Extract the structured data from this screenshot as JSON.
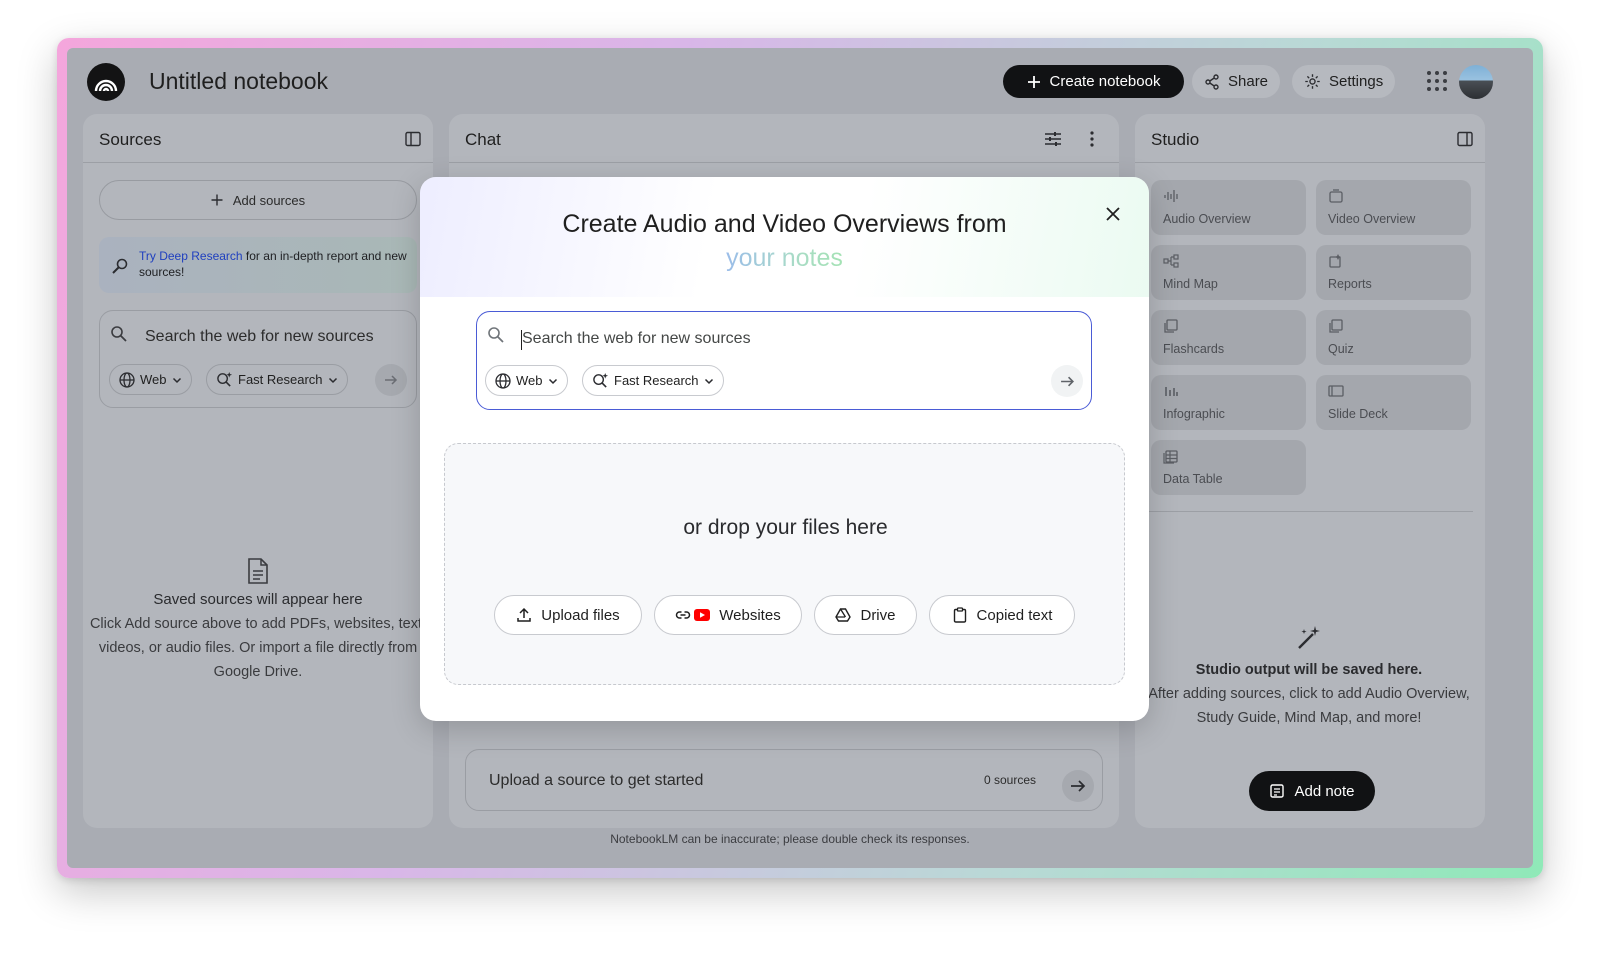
{
  "header": {
    "title": "Untitled notebook",
    "create_label": "Create notebook",
    "share_label": "Share",
    "settings_label": "Settings"
  },
  "sources": {
    "heading": "Sources",
    "add_label": "Add sources",
    "deep_research_link": "Try Deep Research",
    "deep_research_rest": " for an in-depth report and new sources!",
    "search_placeholder": "Search the web for new sources",
    "web_chip": "Web",
    "research_chip": "Fast Research",
    "empty_title": "Saved sources will appear here",
    "empty_body": "Click Add source above to add PDFs, websites, text, videos, or audio files. Or import a file directly from Google Drive."
  },
  "chat": {
    "heading": "Chat",
    "input_placeholder": "Upload a source to get started",
    "source_count": "0 sources",
    "footer": "NotebookLM can be inaccurate; please double check its responses."
  },
  "studio": {
    "heading": "Studio",
    "cards": [
      {
        "label": "Audio Overview",
        "icon": "audio-waveform-icon"
      },
      {
        "label": "Video Overview",
        "icon": "video-icon"
      },
      {
        "label": "Mind Map",
        "icon": "mind-map-icon"
      },
      {
        "label": "Reports",
        "icon": "reports-icon"
      },
      {
        "label": "Flashcards",
        "icon": "flashcards-icon"
      },
      {
        "label": "Quiz",
        "icon": "quiz-icon"
      },
      {
        "label": "Infographic",
        "icon": "infographic-icon"
      },
      {
        "label": "Slide Deck",
        "icon": "slide-deck-icon"
      },
      {
        "label": "Data Table",
        "icon": "data-table-icon"
      }
    ],
    "empty_title": "Studio output will be saved here.",
    "empty_body": "After adding sources, click to add Audio Overview, Study Guide, Mind Map, and more!",
    "add_note_label": "Add note"
  },
  "modal": {
    "title": "Create Audio and Video Overviews from",
    "subtitle": "your notes",
    "search_placeholder": "Search the web for new sources",
    "web_chip": "Web",
    "research_chip": "Fast Research",
    "drop_text": "or drop your files here",
    "buttons": {
      "upload": "Upload files",
      "websites": "Websites",
      "drive": "Drive",
      "copied": "Copied text"
    }
  },
  "colors": {
    "accent_dark": "#111214",
    "search_border": "#4a5bd6",
    "link": "#1f3fbf"
  }
}
